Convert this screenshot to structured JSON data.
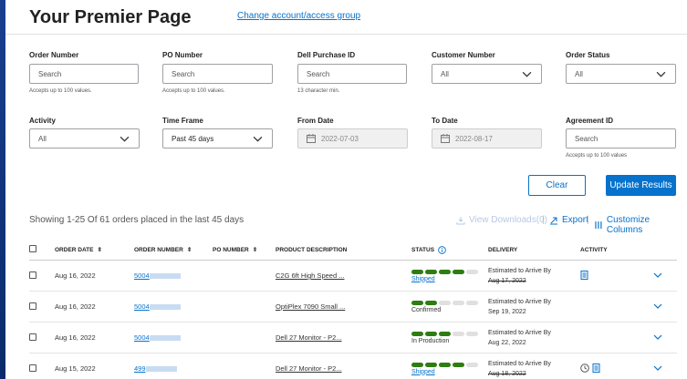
{
  "header": {
    "title": "Your Premier Page",
    "change_link": "Change account/access group"
  },
  "filters": {
    "order_number": {
      "label": "Order Number",
      "placeholder": "Search",
      "hint": "Accepts up to 100 values."
    },
    "po_number": {
      "label": "PO Number",
      "placeholder": "Search",
      "hint": "Accepts up to 100 values."
    },
    "dell_purchase_id": {
      "label": "Dell Purchase ID",
      "placeholder": "Search",
      "hint": "13 character min."
    },
    "customer_number": {
      "label": "Customer Number",
      "value": "All"
    },
    "order_status": {
      "label": "Order Status",
      "value": "All"
    },
    "activity": {
      "label": "Activity",
      "value": "All"
    },
    "time_frame": {
      "label": "Time Frame",
      "value": "Past 45 days"
    },
    "from_date": {
      "label": "From Date",
      "value": "2022-07-03"
    },
    "to_date": {
      "label": "To Date",
      "value": "2022-08-17"
    },
    "agreement_id": {
      "label": "Agreement ID",
      "placeholder": "Search",
      "hint": "Accepts up to 100 values"
    }
  },
  "actions": {
    "clear": "Clear",
    "update": "Update Results"
  },
  "results": {
    "summary": "Showing 1-25 Of 61 orders placed in the last 45 days",
    "view_downloads": "View Downloads(0)",
    "export": "Export",
    "customize": "Customize Columns"
  },
  "table": {
    "headers": {
      "order_date": "ORDER DATE",
      "order_number": "ORDER NUMBER",
      "po_number": "PO NUMBER",
      "product": "PRODUCT DESCRIPTION",
      "status": "STATUS",
      "delivery": "DELIVERY",
      "activity": "ACTIVITY"
    },
    "colors": {
      "progress_on": "#2e7d12",
      "progress_off": "#e0e0e0",
      "link": "#0672cb"
    },
    "rows": [
      {
        "date": "Aug 16, 2022",
        "order": "5004",
        "product": "C2G 6ft High Speed ...",
        "progress": 4,
        "status": "Shipped",
        "status_link": true,
        "delivery_1": "Estimated to Arrive By",
        "delivery_2": "Aug 17, 2022",
        "delivery_strike": true,
        "activity": [
          "document-icon"
        ]
      },
      {
        "date": "Aug 16, 2022",
        "order": "5004",
        "product": "OptiPlex 7090 Small ...",
        "progress": 2,
        "status": "Confirmed",
        "status_link": false,
        "delivery_1": "Estimated to Arrive By",
        "delivery_2": "Sep 19, 2022",
        "delivery_strike": false,
        "activity": []
      },
      {
        "date": "Aug 16, 2022",
        "order": "5004",
        "product": "Dell 27 Monitor - P2...",
        "progress": 3,
        "status": "In Production",
        "status_link": false,
        "delivery_1": "Estimated to Arrive By",
        "delivery_2": "Aug 22, 2022",
        "delivery_strike": false,
        "activity": []
      },
      {
        "date": "Aug 15, 2022",
        "order": "499",
        "product": "Dell 27 Monitor - P2...",
        "progress": 4,
        "status": "Shipped",
        "status_link": true,
        "delivery_1": "Estimated to Arrive By",
        "delivery_2": "Aug 18, 2022",
        "delivery_strike": true,
        "activity": [
          "clock-icon",
          "document-icon"
        ]
      }
    ]
  }
}
